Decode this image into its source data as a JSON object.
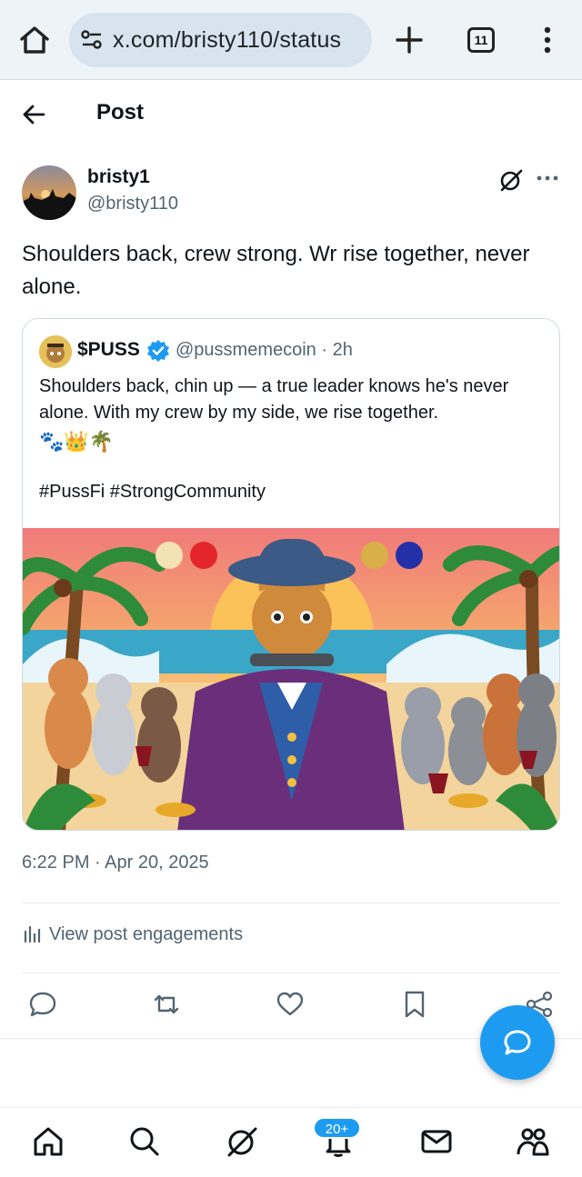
{
  "browser": {
    "url": "x.com/bristy110/status",
    "tab_count": "11"
  },
  "header": {
    "title": "Post"
  },
  "post": {
    "author_name": "bristy1",
    "author_handle": "@bristy110",
    "text": "Shoulders back, crew strong. Wr rise together, never alone.",
    "timestamp": "6:22 PM · Apr 20, 2025",
    "engagements_label": "View post engagements"
  },
  "quote": {
    "name": "$PUSS",
    "handle": "@pussmemecoin · 2h",
    "text": "Shoulders back, chin up — a true leader knows he's never alone. With my crew by my side, we rise together.",
    "emoji": "🐾👑🌴",
    "hashtags": "#PussFi #StrongCommunity"
  },
  "notifications": {
    "badge": "20+"
  },
  "colors": {
    "accent": "#1d9bf0",
    "text": "#0f1419",
    "secondary": "#536471"
  },
  "icons": [
    "home-icon",
    "tune-icon",
    "plus-icon",
    "tabs-icon",
    "menu-dots-icon",
    "back-arrow-icon",
    "grok-icon",
    "more-icon",
    "verified-icon",
    "analytics-icon",
    "reply-icon",
    "retweet-icon",
    "like-icon",
    "bookmark-icon",
    "share-icon",
    "compose-icon",
    "search-icon",
    "bell-icon",
    "mail-icon",
    "communities-icon"
  ]
}
